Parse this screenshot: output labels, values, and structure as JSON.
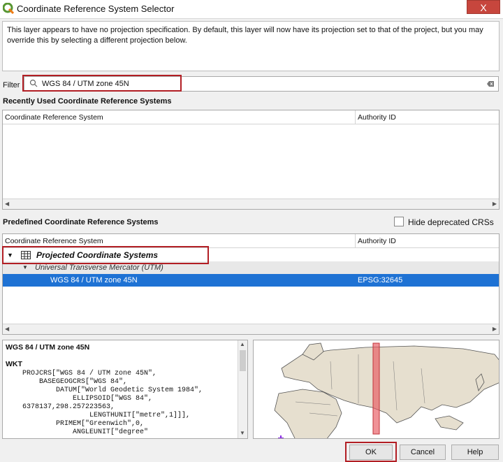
{
  "window": {
    "title": "Coordinate Reference System Selector",
    "close_label": "X"
  },
  "message": "This layer appears to have no projection specification. By default, this layer will now have its projection set to that of the project, but you may override this by selecting a different projection below.",
  "filter": {
    "label": "Filter",
    "value": "WGS 84 / UTM zone 45N"
  },
  "recent": {
    "heading": "Recently Used Coordinate Reference Systems",
    "columns": [
      "Coordinate Reference System",
      "Authority ID"
    ]
  },
  "predefined": {
    "heading": "Predefined Coordinate Reference Systems",
    "hide_deprecated_label": "Hide deprecated CRSs",
    "columns": [
      "Coordinate Reference System",
      "Authority ID"
    ],
    "rows": [
      {
        "label": "Projected Coordinate Systems",
        "authority": ""
      },
      {
        "label": "Universal Transverse Mercator (UTM)",
        "authority": ""
      },
      {
        "label": "WGS 84 / UTM zone 45N",
        "authority": "EPSG:32645"
      }
    ]
  },
  "wkt": {
    "title": "WGS 84 / UTM zone 45N",
    "label": "WKT",
    "text": "    PROJCRS[\"WGS 84 / UTM zone 45N\",\n        BASEGEOGCRS[\"WGS 84\",\n            DATUM[\"World Geodetic System 1984\",\n                ELLIPSOID[\"WGS 84\",\n    6378137,298.257223563,\n                    LENGTHUNIT[\"metre\",1]]],\n            PRIMEM[\"Greenwich\",0,\n                ANGLEUNIT[\"degree\""
  },
  "buttons": {
    "ok": "OK",
    "cancel": "Cancel",
    "help": "Help"
  },
  "colors": {
    "selection": "#1e72d4",
    "highlight": "#b21e24",
    "zone_band": "#e8585f"
  }
}
